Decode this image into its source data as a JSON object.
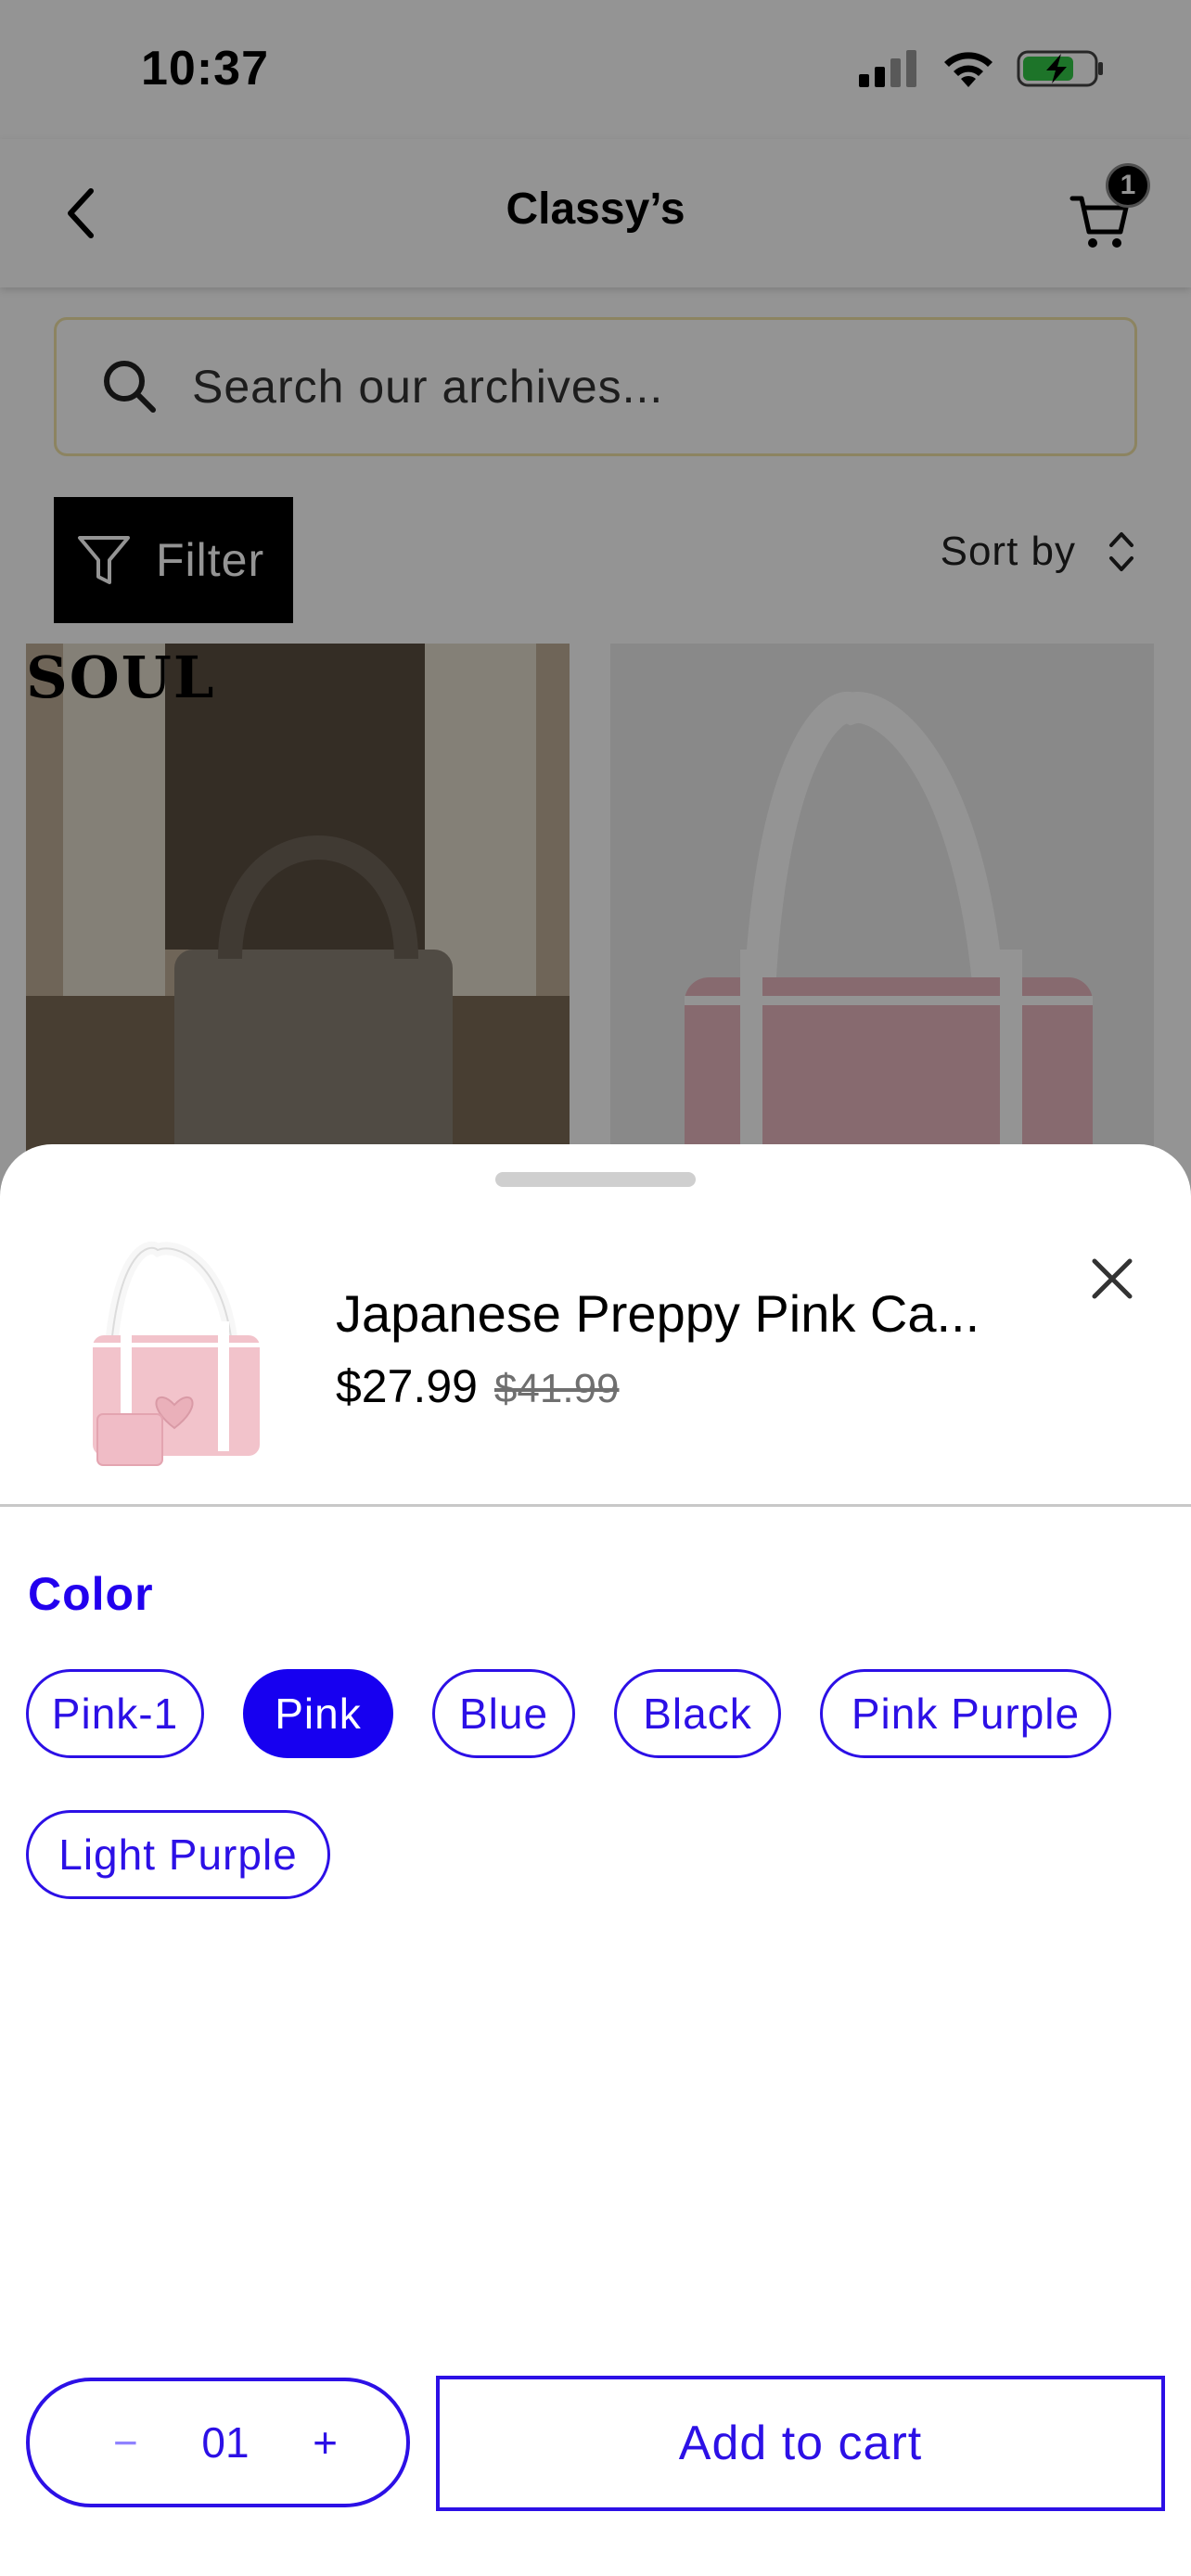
{
  "status_bar": {
    "time": "10:37",
    "icons": [
      "signal-icon",
      "wifi-icon",
      "battery-charging-icon"
    ]
  },
  "nav": {
    "back_icon": "chevron-left-icon",
    "title": "Classy’s",
    "cart_icon": "cart-icon",
    "cart_count": "1"
  },
  "search": {
    "placeholder": "Search our archives...",
    "icon": "search-icon"
  },
  "toolbar": {
    "filter_label": "Filter",
    "filter_icon": "filter-icon",
    "sort_label": "Sort by",
    "sort_icon": "sort-icon"
  },
  "products": [
    {
      "overlay_text": "SOUL"
    },
    {
      "overlay_text": ""
    }
  ],
  "sheet": {
    "product_title": "Japanese Preppy Pink Ca...",
    "price": "$27.99",
    "original_price": "$41.99",
    "color_label": "Color",
    "colors": [
      "Pink-1",
      "Pink",
      "Blue",
      "Black",
      "Pink Purple",
      "Light Purple"
    ],
    "selected_color": "Pink",
    "quantity": {
      "minus": "−",
      "value": "01",
      "plus": "+"
    },
    "add_to_cart_label": "Add to cart"
  },
  "colors": {
    "accent": "#2C10E6",
    "selected_chip": "#1700F0",
    "overlay": "rgba(0,0,0,0.42)"
  }
}
